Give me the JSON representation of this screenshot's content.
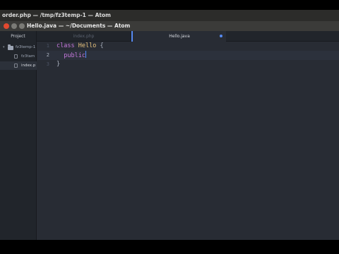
{
  "os_title": "order.php — /tmp/fz3temp-1 — Atom",
  "window_title": "Hello.java — ~/Documents — Atom",
  "tabs": {
    "project": "Project",
    "index": "index.php",
    "hello": "Hello.java"
  },
  "tree": {
    "root": "fz3temp-1",
    "items": [
      "fz3tam",
      "index.p"
    ]
  },
  "editor": {
    "line_numbers": [
      "1",
      "2",
      "3"
    ],
    "line1": {
      "kw": "class",
      "name": "Hello",
      "brace": "{"
    },
    "line2": {
      "kw": "public"
    },
    "line3": {
      "brace": "}"
    }
  },
  "colors": {
    "accent": "#568af2",
    "keyword": "#c678dd",
    "class_name": "#e5c07b",
    "editor_bg": "#282c34"
  }
}
